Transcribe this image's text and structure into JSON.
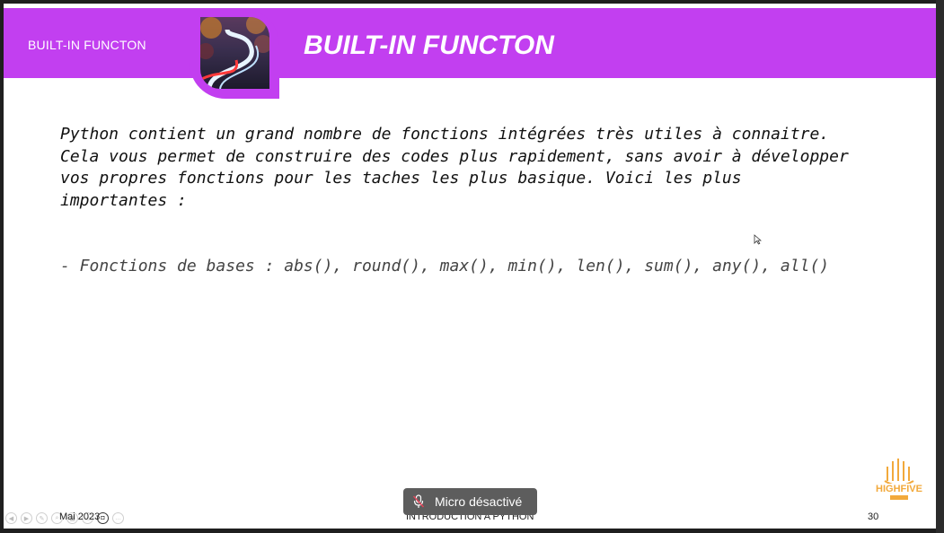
{
  "banner": {
    "small_title": "BUILT-IN FUNCTON",
    "title": "BUILT-IN FUNCTON"
  },
  "content": {
    "paragraph": "Python contient un grand nombre de fonctions intégrées très utiles à connaitre.\nCela vous permet de construire des codes plus rapidement, sans avoir à développer\nvos propres fonctions pour les taches les plus basique. Voici les plus\nimportantes :",
    "list_item": "- Fonctions de bases : abs(), round(), max(), min(), len(), sum(), any(), all()"
  },
  "footer": {
    "date": "Mai 2023",
    "center": "INTRODUCTION A PYTHON",
    "page": "30"
  },
  "logo": {
    "text": "HIGHFIVE",
    "color": "#f2a93b"
  },
  "toast": {
    "label": "Micro désactivé",
    "icon": "mic-off-icon"
  },
  "colors": {
    "banner": "#c23ff0"
  }
}
